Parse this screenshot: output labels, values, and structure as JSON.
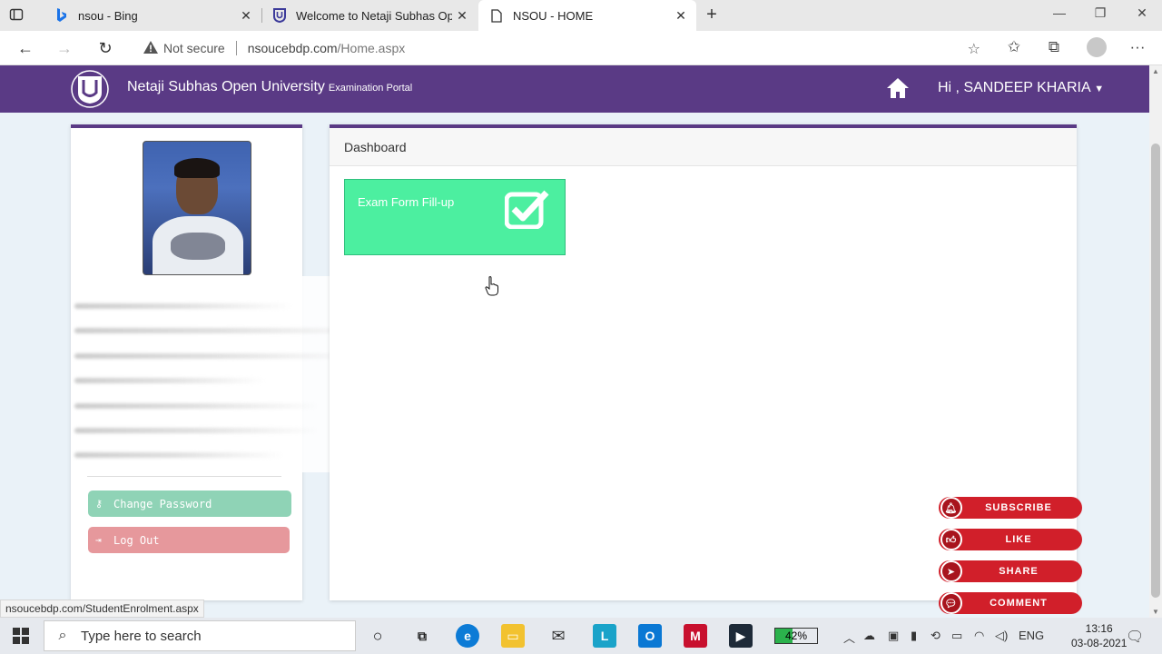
{
  "browser": {
    "tabs": [
      {
        "title": "nsou - Bing",
        "favicon": "bing-icon",
        "active": false
      },
      {
        "title": "Welcome to Netaji Subhas Open",
        "favicon": "nsou-shield-icon",
        "active": false
      },
      {
        "title": "NSOU - HOME",
        "favicon": "page-icon",
        "active": true
      }
    ],
    "new_tab": "+",
    "address": {
      "security_label": "Not secure",
      "domain": "nsoucebdp.com",
      "path": "/Home.aspx"
    },
    "status_url": "nsoucebdp.com/StudentEnrolment.aspx"
  },
  "site": {
    "name": "Netaji Subhas Open University",
    "subtitle": "Examination Portal",
    "user_greeting": "Hi , SANDEEP KHARIA",
    "colors": {
      "header": "#5a3a85",
      "tile": "#4cefa0"
    }
  },
  "sidebar": {
    "change_password": "Change Password",
    "log_out": "Log Out"
  },
  "dashboard": {
    "title": "Dashboard",
    "tiles": [
      {
        "label": "Exam Form Fill-up",
        "icon": "check-square-icon"
      }
    ]
  },
  "overlay": {
    "buttons": [
      {
        "label": "SUBSCRIBE",
        "icon": "bell-icon"
      },
      {
        "label": "LIKE",
        "icon": "thumbs-up-icon"
      },
      {
        "label": "SHARE",
        "icon": "share-arrow-icon"
      },
      {
        "label": "COMMENT",
        "icon": "comment-icon"
      }
    ]
  },
  "taskbar": {
    "search_placeholder": "Type here to search",
    "battery": "42%",
    "battery_level": 0.42,
    "language": "ENG",
    "time": "13:16",
    "date": "03-08-2021"
  }
}
